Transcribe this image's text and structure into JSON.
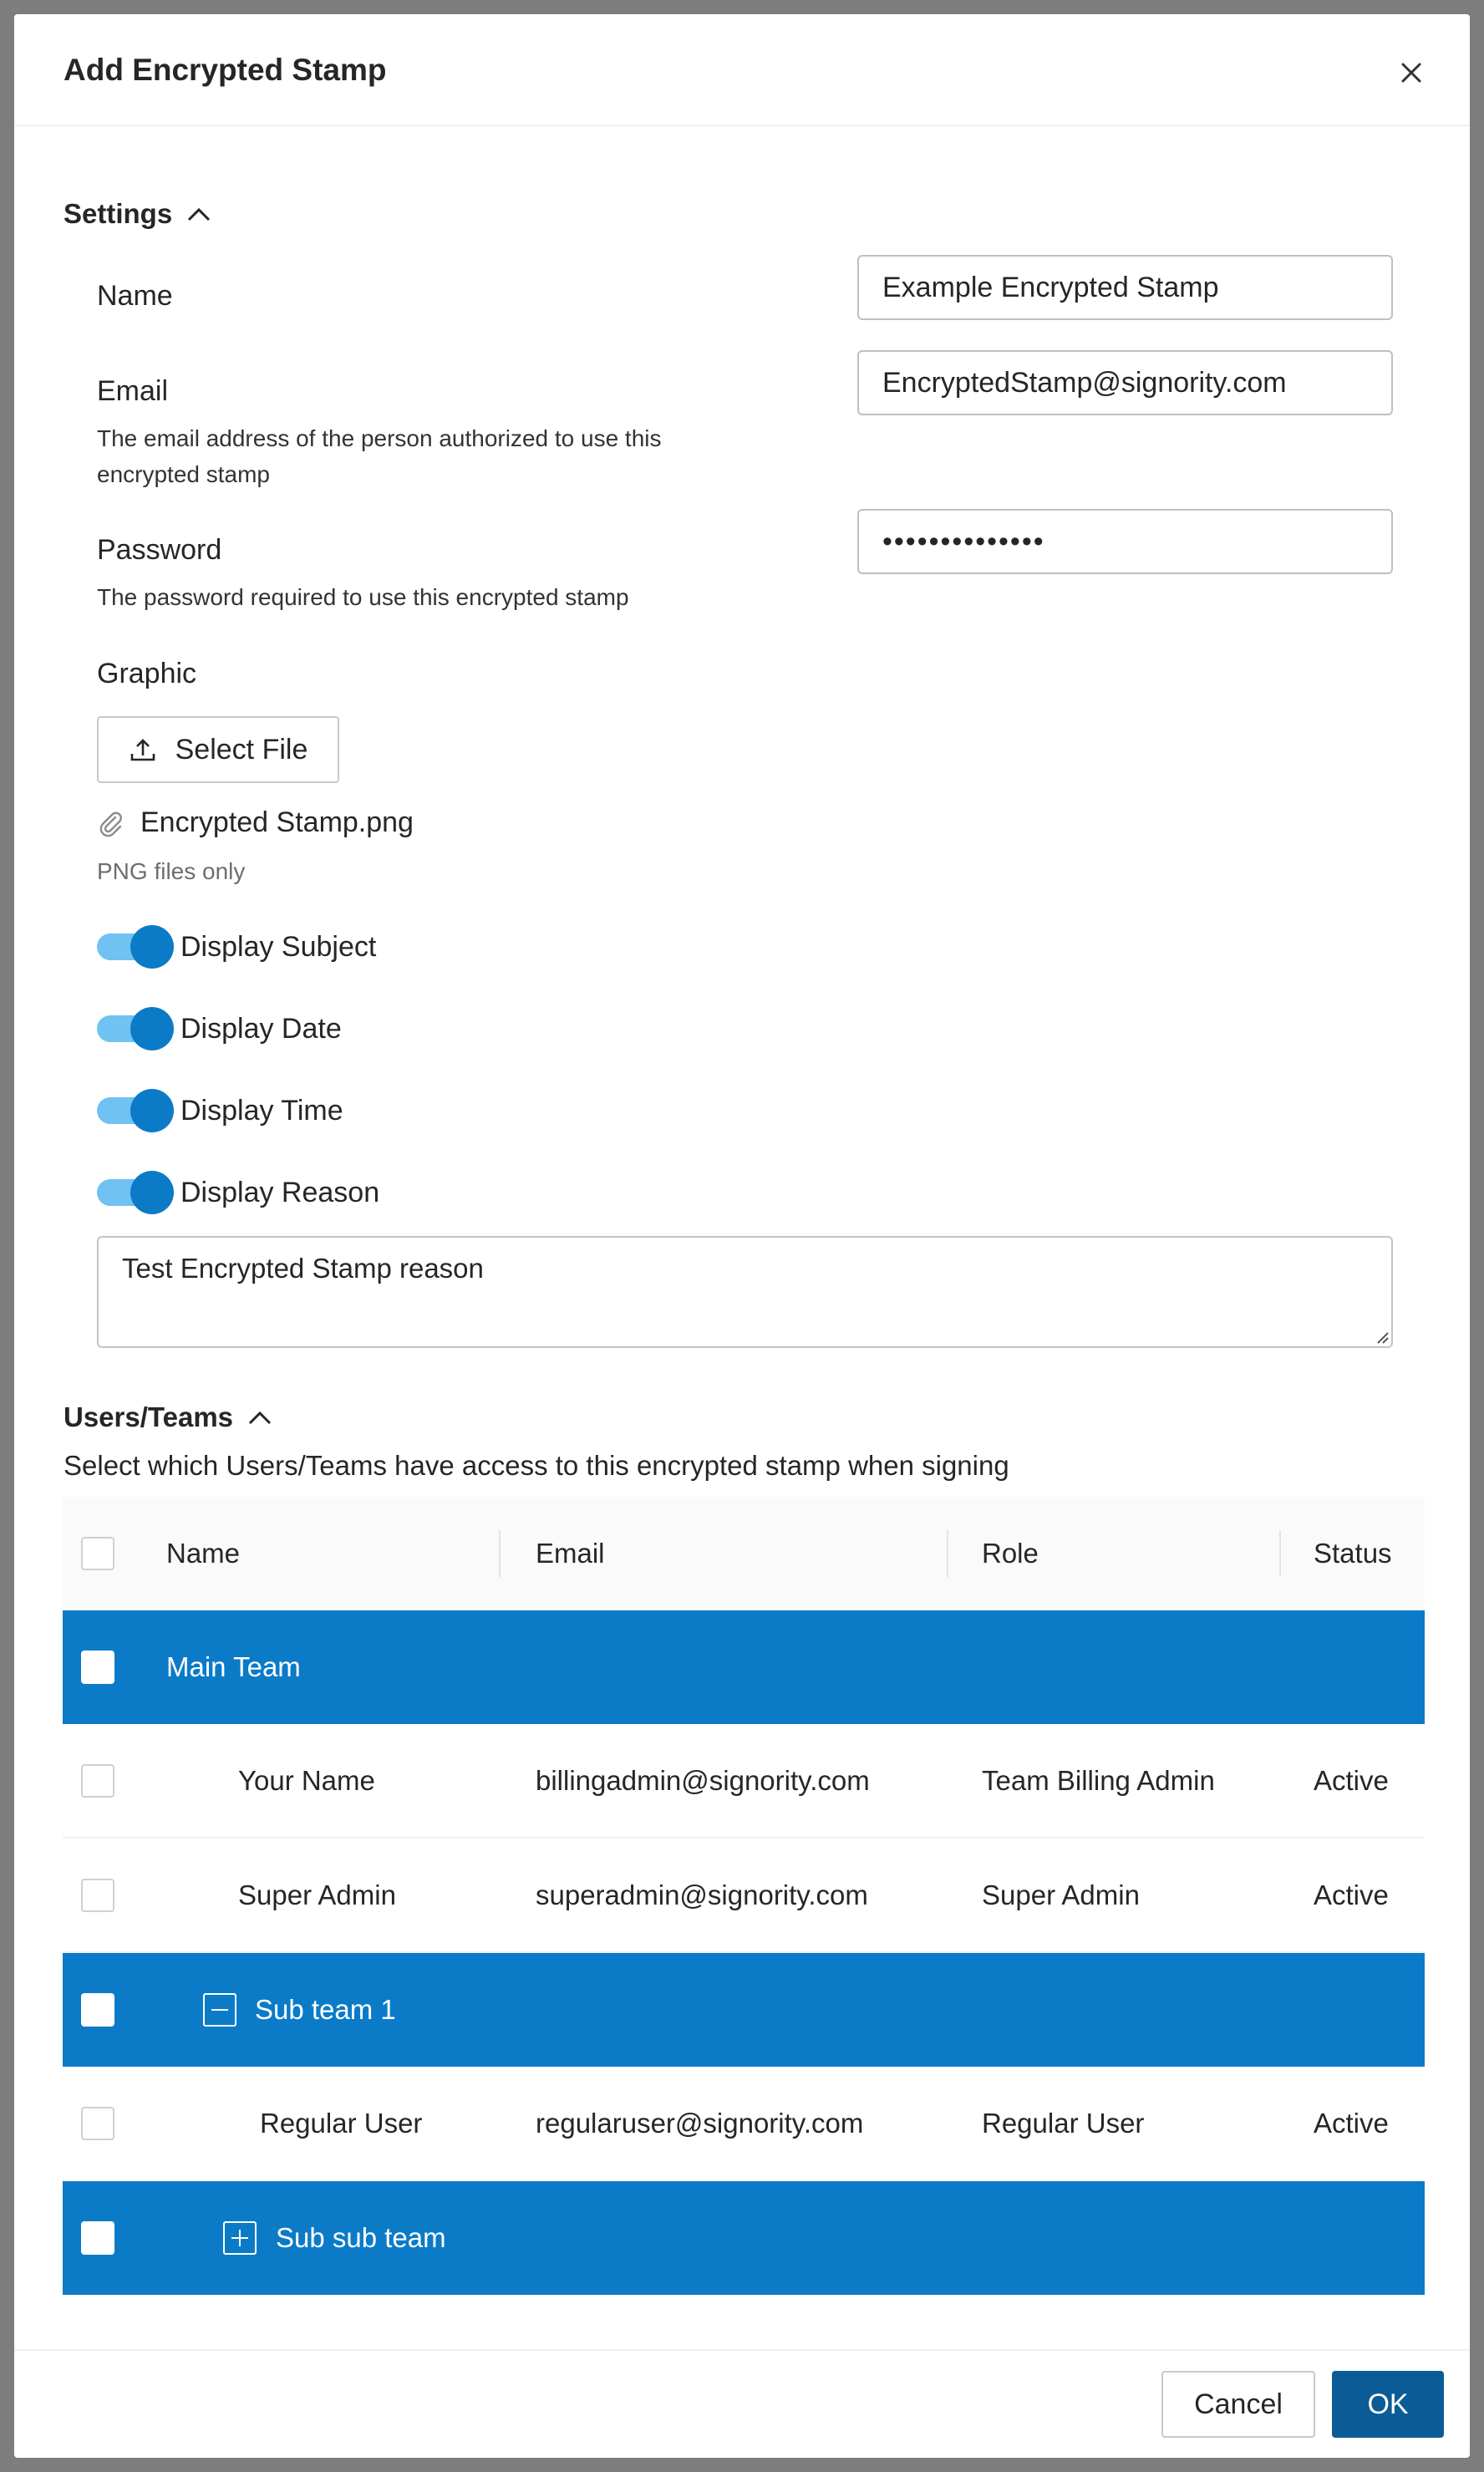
{
  "dialog": {
    "title": "Add Encrypted Stamp"
  },
  "settings": {
    "section_label": "Settings",
    "name": {
      "label": "Name",
      "value": "Example Encrypted Stamp"
    },
    "email": {
      "label": "Email",
      "description": "The email address of the person authorized to use this encrypted stamp",
      "value": "EncryptedStamp@signority.com"
    },
    "password": {
      "label": "Password",
      "description": "The password required to use this encrypted stamp",
      "value": "••••••••••••••"
    },
    "graphic": {
      "label": "Graphic",
      "select_file_label": "Select File",
      "file_name": "Encrypted Stamp.png",
      "note": "PNG files only"
    },
    "toggles": [
      {
        "label": "Display Subject",
        "on": true
      },
      {
        "label": "Display Date",
        "on": true
      },
      {
        "label": "Display Time",
        "on": true
      },
      {
        "label": "Display Reason",
        "on": true
      }
    ],
    "reason_value": "Test Encrypted Stamp reason"
  },
  "users_teams": {
    "section_label": "Users/Teams",
    "description": "Select which Users/Teams have access to this encrypted stamp when signing",
    "columns": [
      "Name",
      "Email",
      "Role",
      "Status"
    ],
    "rows": [
      {
        "type": "team",
        "name": "Main Team"
      },
      {
        "type": "user",
        "name": "Your Name",
        "email": "billingadmin@signority.com",
        "role": "Team Billing Admin",
        "status": "Active"
      },
      {
        "type": "user",
        "name": "Super Admin",
        "email": "superadmin@signority.com",
        "role": "Super Admin",
        "status": "Active"
      },
      {
        "type": "team",
        "name": "Sub team 1",
        "expander": "collapse"
      },
      {
        "type": "user",
        "name": "Regular User",
        "email": "regularuser@signority.com",
        "role": "Regular User",
        "status": "Active"
      },
      {
        "type": "team",
        "name": "Sub sub team",
        "expander": "expand"
      }
    ]
  },
  "footer": {
    "cancel_label": "Cancel",
    "ok_label": "OK"
  },
  "colors": {
    "primary": "#0b7bc8",
    "ok_button": "#0b5c96",
    "toggle_track": "#6fc2f2"
  }
}
